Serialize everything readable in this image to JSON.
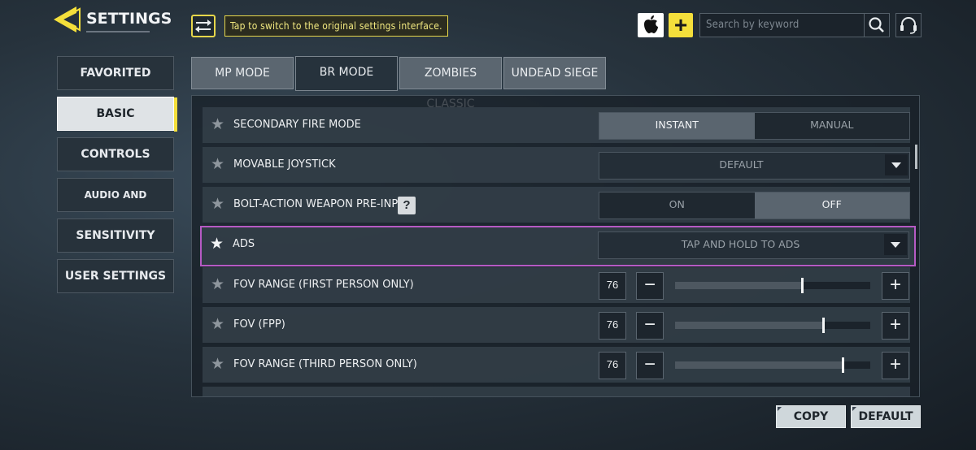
{
  "header": {
    "title": "SETTINGS",
    "switch_tip": "Tap to switch to the original settings interface.",
    "plus_symbol": "+",
    "search_placeholder": "Search by keyword",
    "accent_color": "#f4df3b"
  },
  "nav": {
    "items": [
      {
        "label": "FAVORITED",
        "active": false
      },
      {
        "label": "BASIC",
        "active": true
      },
      {
        "label": "CONTROLS",
        "active": false
      },
      {
        "label": "AUDIO AND GRAPHICS",
        "active": false
      },
      {
        "label": "SENSITIVITY",
        "active": false
      },
      {
        "label": "USER SETTINGS",
        "active": false
      }
    ]
  },
  "modes": {
    "tabs": [
      {
        "label": "MP MODE",
        "active": false
      },
      {
        "label": "BR MODE",
        "active": true
      },
      {
        "label": "ZOMBIES CLASSIC",
        "active": false
      },
      {
        "label": "UNDEAD SIEGE",
        "active": false
      }
    ]
  },
  "settings": {
    "secondary_fire": {
      "label": "SECONDARY FIRE MODE",
      "options": [
        "INSTANT",
        "MANUAL"
      ],
      "selected": "INSTANT"
    },
    "movable_joystick": {
      "label": "MOVABLE JOYSTICK",
      "value": "DEFAULT"
    },
    "bolt_action": {
      "label": "BOLT-ACTION WEAPON PRE-INPUT",
      "help": "?",
      "options": [
        "ON",
        "OFF"
      ],
      "selected": "OFF"
    },
    "ads": {
      "label": "ADS",
      "value": "TAP AND HOLD TO ADS",
      "highlight_color": "#b65ac4"
    },
    "fov_range_first": {
      "label": "FOV RANGE (FIRST PERSON ONLY)",
      "value": "76",
      "slider_fraction": 0.65
    },
    "fov_fpp": {
      "label": "FOV (FPP)",
      "value": "76",
      "slider_fraction": 0.76
    },
    "fov_range_third": {
      "label": "FOV RANGE (THIRD PERSON ONLY)",
      "value": "76",
      "slider_fraction": 0.86
    },
    "minus_symbol": "−",
    "plus_symbol": "+"
  },
  "footer": {
    "copy_label": "COPY",
    "default_label": "DEFAULT"
  }
}
